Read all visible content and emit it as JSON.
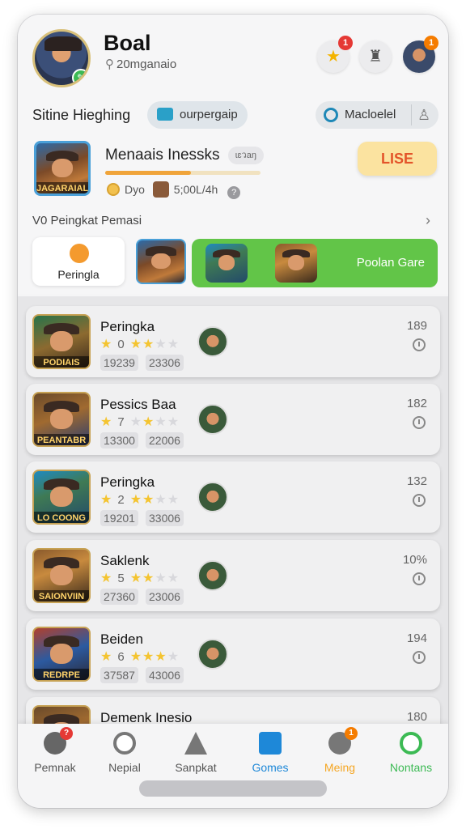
{
  "header": {
    "user_name": "Boal",
    "user_sub": "20mganaio",
    "star_count": "1",
    "profile_count": "1"
  },
  "section": {
    "title": "Sitine Hieghing",
    "pill_label": "ourpergaip",
    "search_value": "Macloelel"
  },
  "featured": {
    "art_caption": "JAGARAIAL",
    "title": "Menaais Inessks",
    "tag": "ɩɛวaŋ",
    "progress": 0.55,
    "meta_a": "Dyo",
    "meta_b": "5;00L/4h",
    "button_label": "LISE"
  },
  "ranking": {
    "title": "V0 Peingkat Pemasi",
    "tile_label": "Peringla",
    "panel_label": "Poolan Gare"
  },
  "games": [
    {
      "title": "Peringka",
      "rating": "0",
      "stars": 3,
      "chip1": "19239",
      "chip2": "23306",
      "number": "189",
      "caption": "PODIAIS"
    },
    {
      "title": "Pessics Baa",
      "rating": "7",
      "stars": 2,
      "chip1": "13300",
      "chip2": "22006",
      "number": "182",
      "caption": "PEANTABR"
    },
    {
      "title": "Peringka",
      "rating": "2",
      "stars": 3,
      "chip1": "19201",
      "chip2": "33006",
      "number": "132",
      "caption": "LO COONG"
    },
    {
      "title": "Saklenk",
      "rating": "5",
      "stars": 2,
      "chip1": "27360",
      "chip2": "23006",
      "number": "10%",
      "caption": "SAIONVIIN"
    },
    {
      "title": "Beiden",
      "rating": "6",
      "stars": 3,
      "chip1": "37587",
      "chip2": "43006",
      "number": "194",
      "caption": "REDRPE"
    },
    {
      "title": "Demenk Inesio",
      "rating": "",
      "stars": 0,
      "chip1": "",
      "chip2": "",
      "number": "180",
      "caption": ""
    }
  ],
  "nav": [
    {
      "label": "Pemnak",
      "badge": "?"
    },
    {
      "label": "Nepial",
      "badge": ""
    },
    {
      "label": "Sanpkat",
      "badge": ""
    },
    {
      "label": "Gomes",
      "badge": ""
    },
    {
      "label": "Meing",
      "badge": "1"
    },
    {
      "label": "Nontans",
      "badge": ""
    }
  ],
  "colors": {
    "accent_green": "#62c548",
    "accent_blue": "#1e88d8",
    "accent_orange": "#f5a623",
    "use_button_text": "#e3542a"
  }
}
